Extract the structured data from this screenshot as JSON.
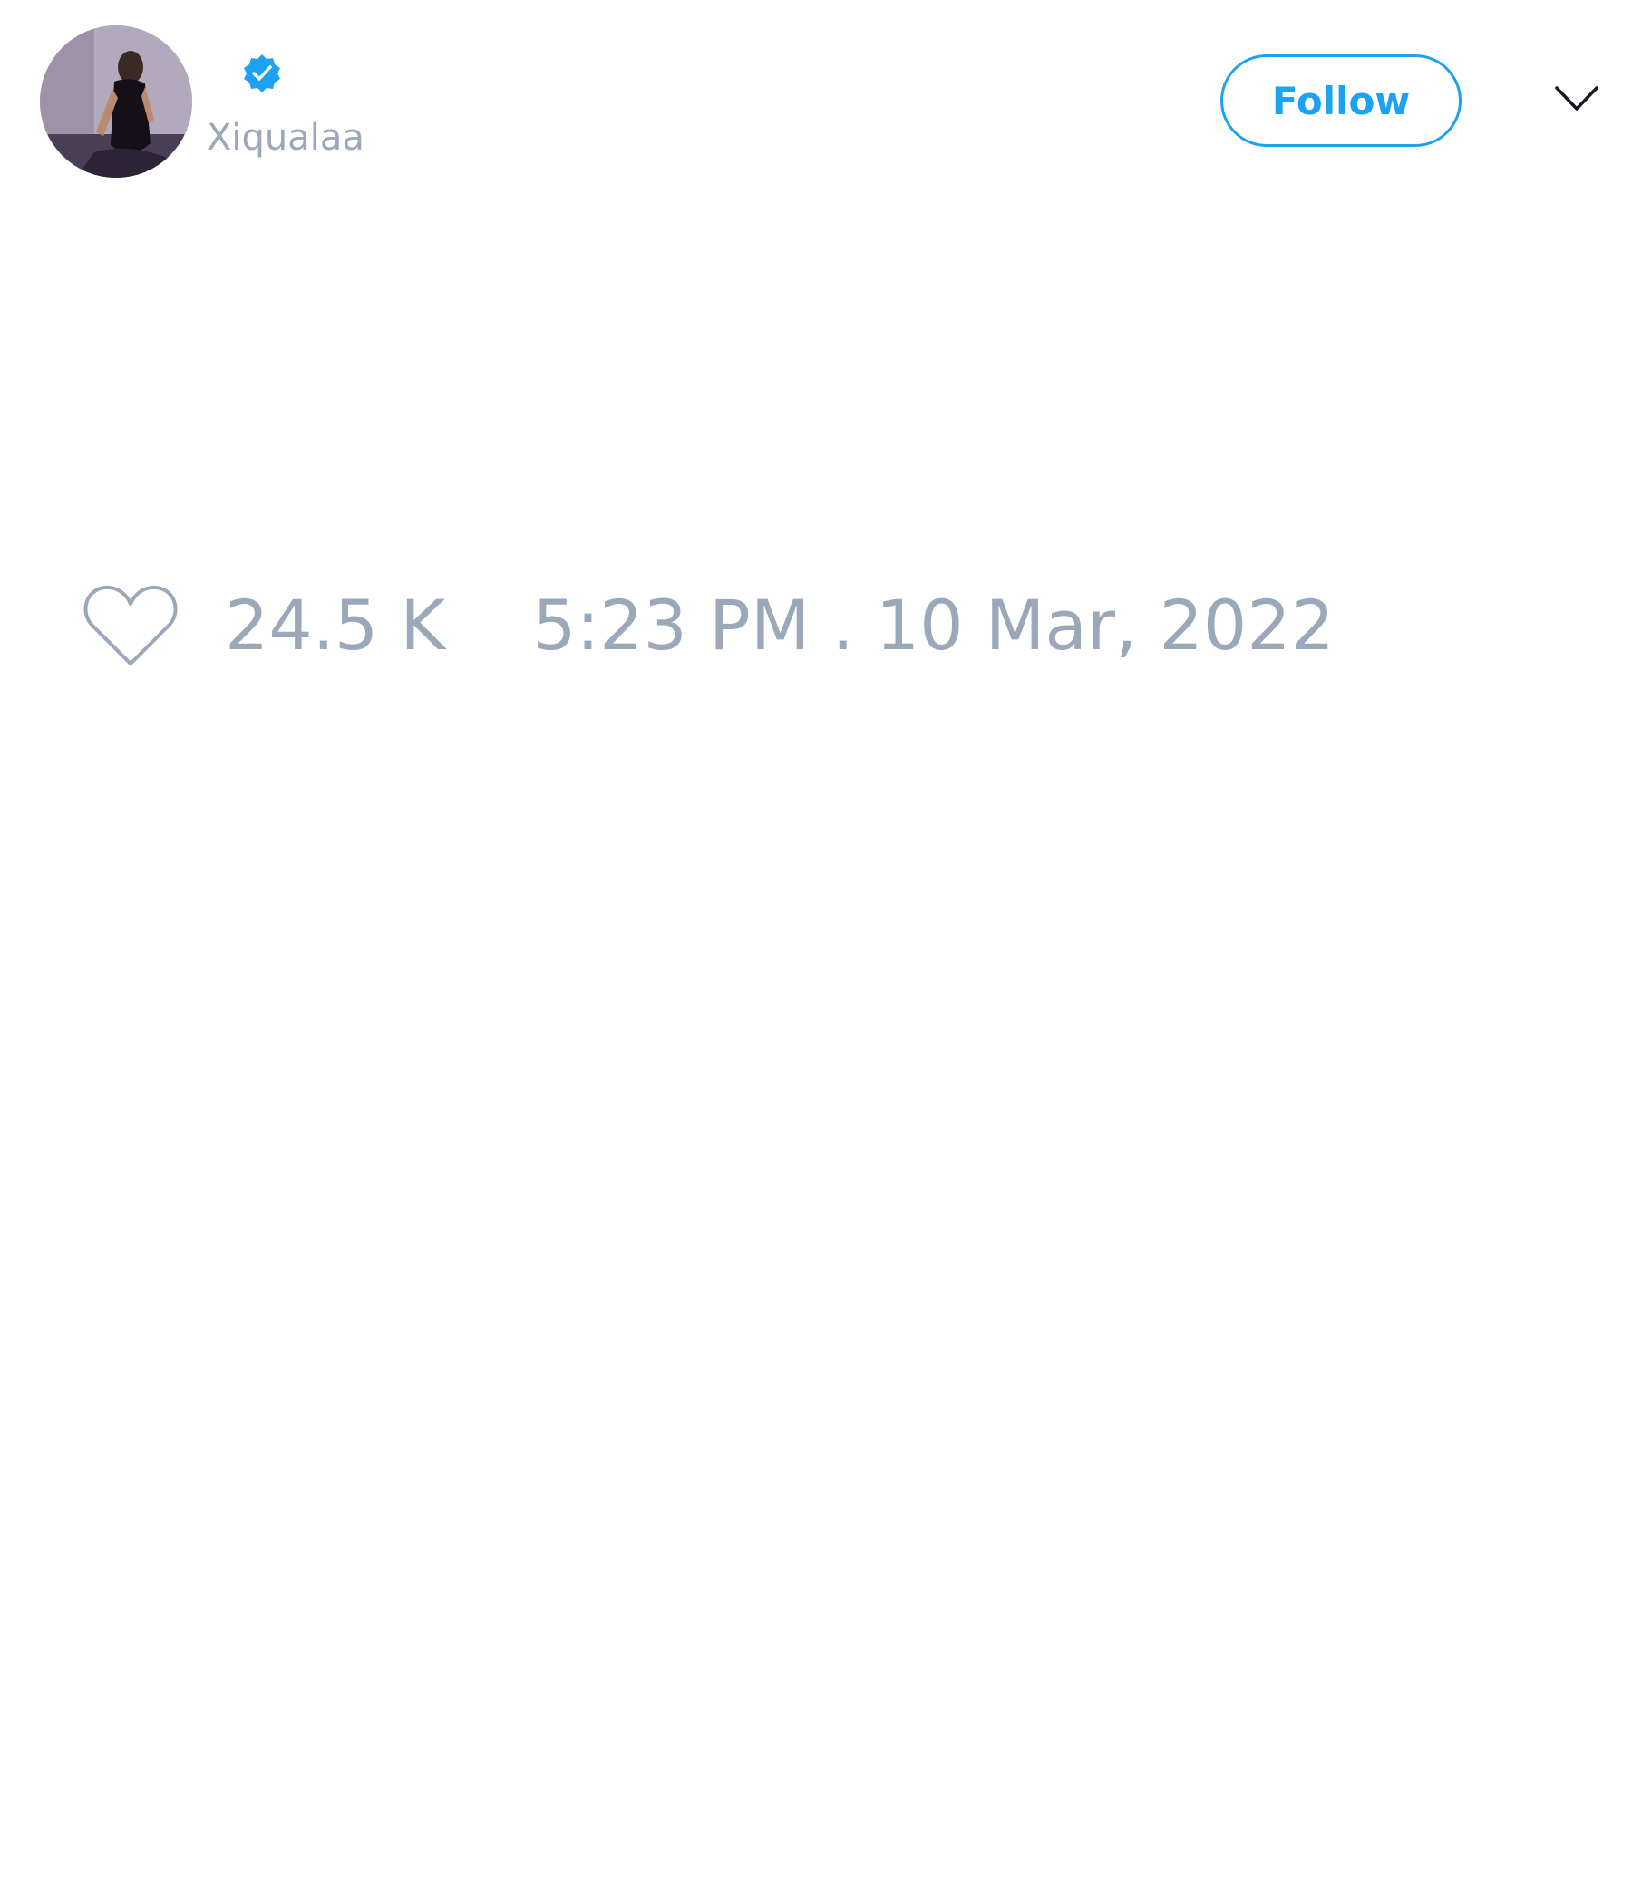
{
  "tweet": {
    "author": {
      "handle": "Xiqualaa",
      "avatar_icon": "profile-photo",
      "verified_icon": "verified-badge-icon"
    },
    "follow_label": "Follow",
    "menu_icon": "chevron-down-icon",
    "likes_icon": "heart-icon",
    "likes_count": "24.5 K",
    "timestamp": "5:23 PM . 10 Mar, 2022"
  },
  "colors": {
    "accent": "#1da1f2",
    "muted_text": "#9aa8ba",
    "background": "#ffffff"
  }
}
